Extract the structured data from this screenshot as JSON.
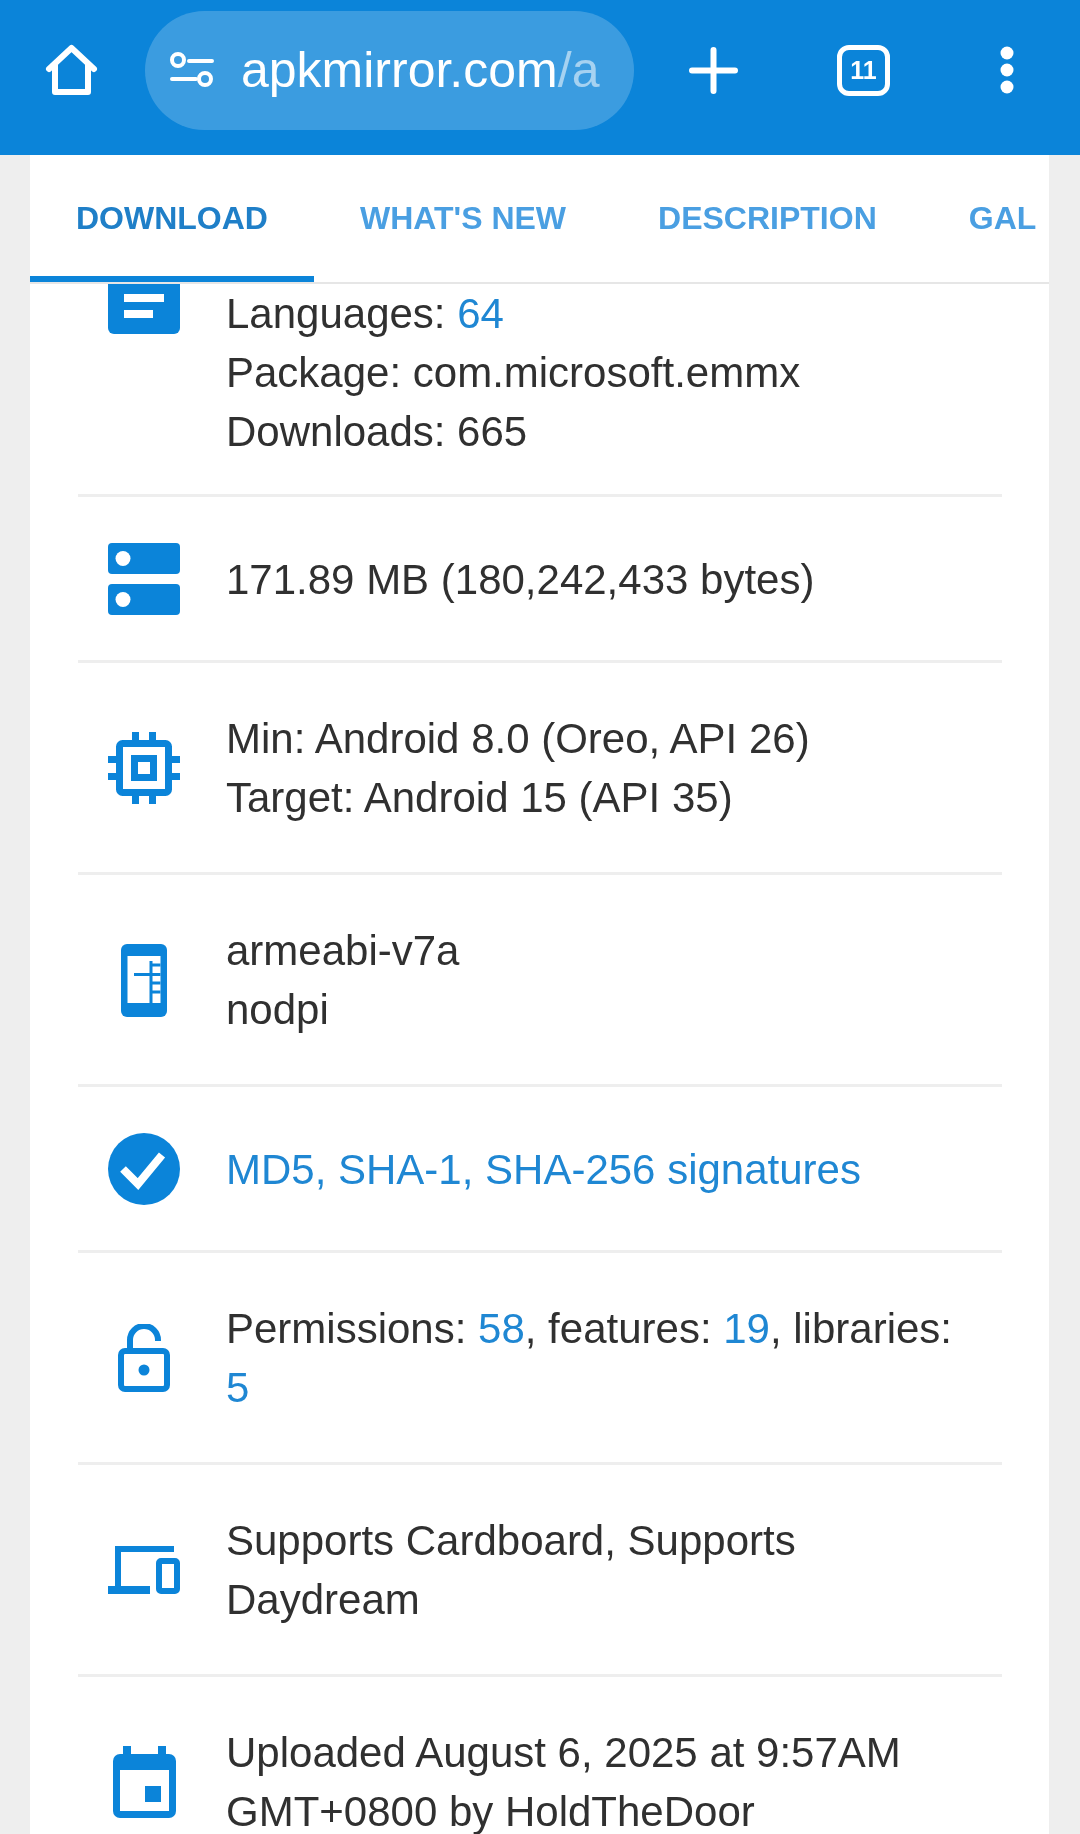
{
  "browser_bar": {
    "address": {
      "host": "apkmirror.com",
      "path": "/a"
    },
    "tab_count": "11"
  },
  "tabs": [
    {
      "label": "DOWNLOAD",
      "selected": true
    },
    {
      "label": "WHAT'S NEW",
      "selected": false
    },
    {
      "label": "DESCRIPTION",
      "selected": false
    },
    {
      "label": "GAL",
      "selected": false
    }
  ],
  "details": [
    {
      "kind": "meta",
      "paragraphs": [
        [
          {
            "kind": "plain",
            "text": "Languages: "
          },
          {
            "kind": "link",
            "text": "64"
          }
        ],
        [
          {
            "kind": "plain",
            "text": "Package: com.microsoft.emmx"
          }
        ],
        [
          {
            "kind": "plain",
            "text": "Downloads: 665"
          }
        ]
      ]
    },
    {
      "kind": "size",
      "paragraphs": [
        [
          {
            "kind": "plain",
            "text": "171.89 MB (180,242,433 bytes)"
          }
        ]
      ]
    },
    {
      "kind": "sdk",
      "paragraphs": [
        [
          {
            "kind": "plain",
            "text": "Min: Android 8.0 (Oreo, API 26)"
          }
        ],
        [
          {
            "kind": "plain",
            "text": "Target: Android 15 (API 35)"
          }
        ]
      ]
    },
    {
      "kind": "abi",
      "paragraphs": [
        [
          {
            "kind": "plain",
            "text": "armeabi-v7a"
          }
        ],
        [
          {
            "kind": "plain",
            "text": "nodpi"
          }
        ]
      ]
    },
    {
      "kind": "signature",
      "paragraphs": [
        [
          {
            "kind": "link",
            "text": "MD5, SHA-1, SHA-256 signatures"
          }
        ]
      ]
    },
    {
      "kind": "permissions",
      "paragraphs": [
        [
          {
            "kind": "plain",
            "text": "Permissions: "
          },
          {
            "kind": "link",
            "text": "58"
          },
          {
            "kind": "plain",
            "text": ", features: "
          },
          {
            "kind": "link",
            "text": "19"
          },
          {
            "kind": "plain",
            "text": ", libraries: "
          },
          {
            "kind": "link",
            "text": "5"
          }
        ]
      ]
    },
    {
      "kind": "support",
      "paragraphs": [
        [
          {
            "kind": "plain",
            "text": "Supports Cardboard, Supports Daydream"
          }
        ]
      ]
    },
    {
      "kind": "upload",
      "paragraphs": [
        [
          {
            "kind": "plain",
            "text": "Uploaded August 6, 2025 at 9:57AM GMT+0800 by HoldTheDoor"
          }
        ]
      ]
    }
  ]
}
